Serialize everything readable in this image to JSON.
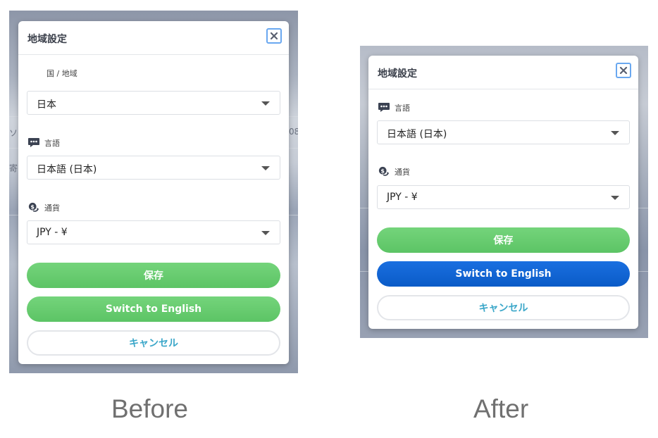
{
  "captions": {
    "before": "Before",
    "after": "After"
  },
  "background_peek": {
    "left_char": "ソ",
    "right_num": "08",
    "left_char2": "寄"
  },
  "before": {
    "title": "地域設定",
    "country_label": "国 / 地域",
    "country_value": "日本",
    "language_label": "言語",
    "language_value": "日本語 (日本)",
    "currency_label": "通貨",
    "currency_value": "JPY - ¥",
    "save_label": "保存",
    "switch_label": "Switch to English",
    "cancel_label": "キャンセル"
  },
  "after": {
    "title": "地域設定",
    "language_label": "言語",
    "language_value": "日本語 (日本)",
    "currency_label": "通貨",
    "currency_value": "JPY - ¥",
    "save_label": "保存",
    "switch_label": "Switch to English",
    "cancel_label": "キャンセル"
  },
  "icons": [
    "close-icon",
    "chat-bubble-icon",
    "currency-exchange-icon",
    "dropdown-caret-icon"
  ],
  "colors": {
    "green": "#66cb6f",
    "blue": "#0a63d4",
    "cancel_text": "#3ba7c9",
    "close_border": "#6aa8f0"
  }
}
